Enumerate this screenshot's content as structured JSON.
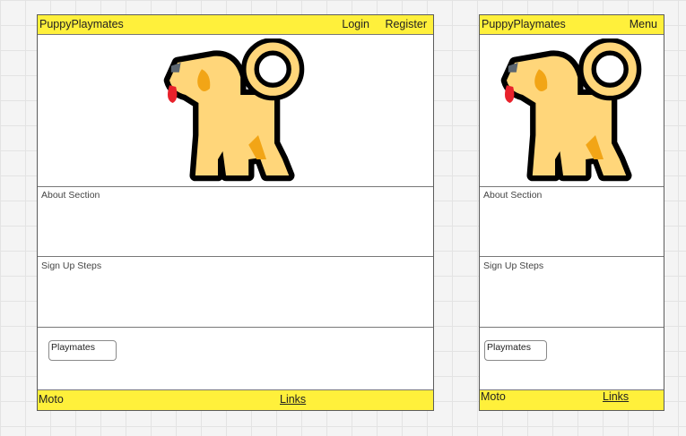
{
  "desktop": {
    "header": {
      "brand": "PuppyPlaymates",
      "login": "Login",
      "register": "Register"
    },
    "hero": {
      "image_icon": "dog-icon"
    },
    "about": {
      "title": "About Section"
    },
    "signup": {
      "title": "Sign Up Steps"
    },
    "playmates_button": "Playmates",
    "footer": {
      "left_text": "Moto",
      "link": "Links"
    }
  },
  "mobile": {
    "header": {
      "brand": "PuppyPlaymates",
      "menu": "Menu"
    },
    "hero": {
      "image_icon": "dog-icon"
    },
    "about": {
      "title": "About Section"
    },
    "signup": {
      "title": "Sign Up Steps"
    },
    "playmates_button": "Playmates",
    "footer": {
      "left_text": "Moto",
      "link": "Links"
    }
  },
  "colors": {
    "accent_yellow": "#fff03b",
    "dog_body": "#ffd67a",
    "dog_spots": "#f2a516",
    "dog_tongue": "#e8212b",
    "outline": "#000000",
    "nose": "#5c6670"
  }
}
